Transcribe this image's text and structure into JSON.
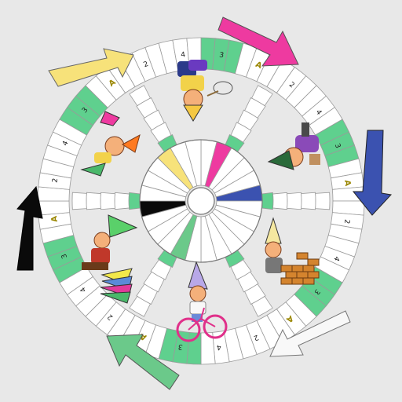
{
  "colors": {
    "background": "#e8e8e8",
    "board": "#ffffff",
    "track_line": "#9a9a9a",
    "safe_green": "#5fd08e",
    "label_text": "#222222",
    "label_a": "#c8b000",
    "yellow": "#f7e27a",
    "magenta": "#ee3aa0",
    "blue": "#3b52b0",
    "white_player": "#f8f8f8",
    "green": "#6bc98a",
    "black": "#0a0a0a"
  },
  "players": [
    {
      "color": "magenta",
      "arrow": "arrow-magenta"
    },
    {
      "color": "blue",
      "arrow": "arrow-blue"
    },
    {
      "color": "white_player",
      "arrow": "arrow-white"
    },
    {
      "color": "green",
      "arrow": "arrow-green"
    },
    {
      "color": "black",
      "arrow": "arrow-black"
    },
    {
      "color": "yellow",
      "arrow": "arrow-yellow"
    }
  ],
  "track_labels": [
    {
      "text": "3"
    },
    {
      "text": "A"
    },
    {
      "text": "2"
    },
    {
      "text": "4"
    },
    {
      "text": "3"
    },
    {
      "text": "A"
    },
    {
      "text": "2"
    },
    {
      "text": "4"
    },
    {
      "text": "3"
    },
    {
      "text": "A"
    },
    {
      "text": "2"
    },
    {
      "text": "4"
    },
    {
      "text": "3"
    },
    {
      "text": "A"
    },
    {
      "text": "2"
    },
    {
      "text": "4"
    },
    {
      "text": "3"
    },
    {
      "text": "A"
    },
    {
      "text": "2"
    },
    {
      "text": "4"
    },
    {
      "text": "3"
    },
    {
      "text": "A"
    },
    {
      "text": "2"
    },
    {
      "text": "4"
    }
  ],
  "icons": [
    "gnome-handstand-icon",
    "gnome-leaning-icon",
    "gnome-bricklayer-icon",
    "gnome-bicycle-icon",
    "gnome-sitting-icon",
    "gnome-megaphone-icon"
  ]
}
